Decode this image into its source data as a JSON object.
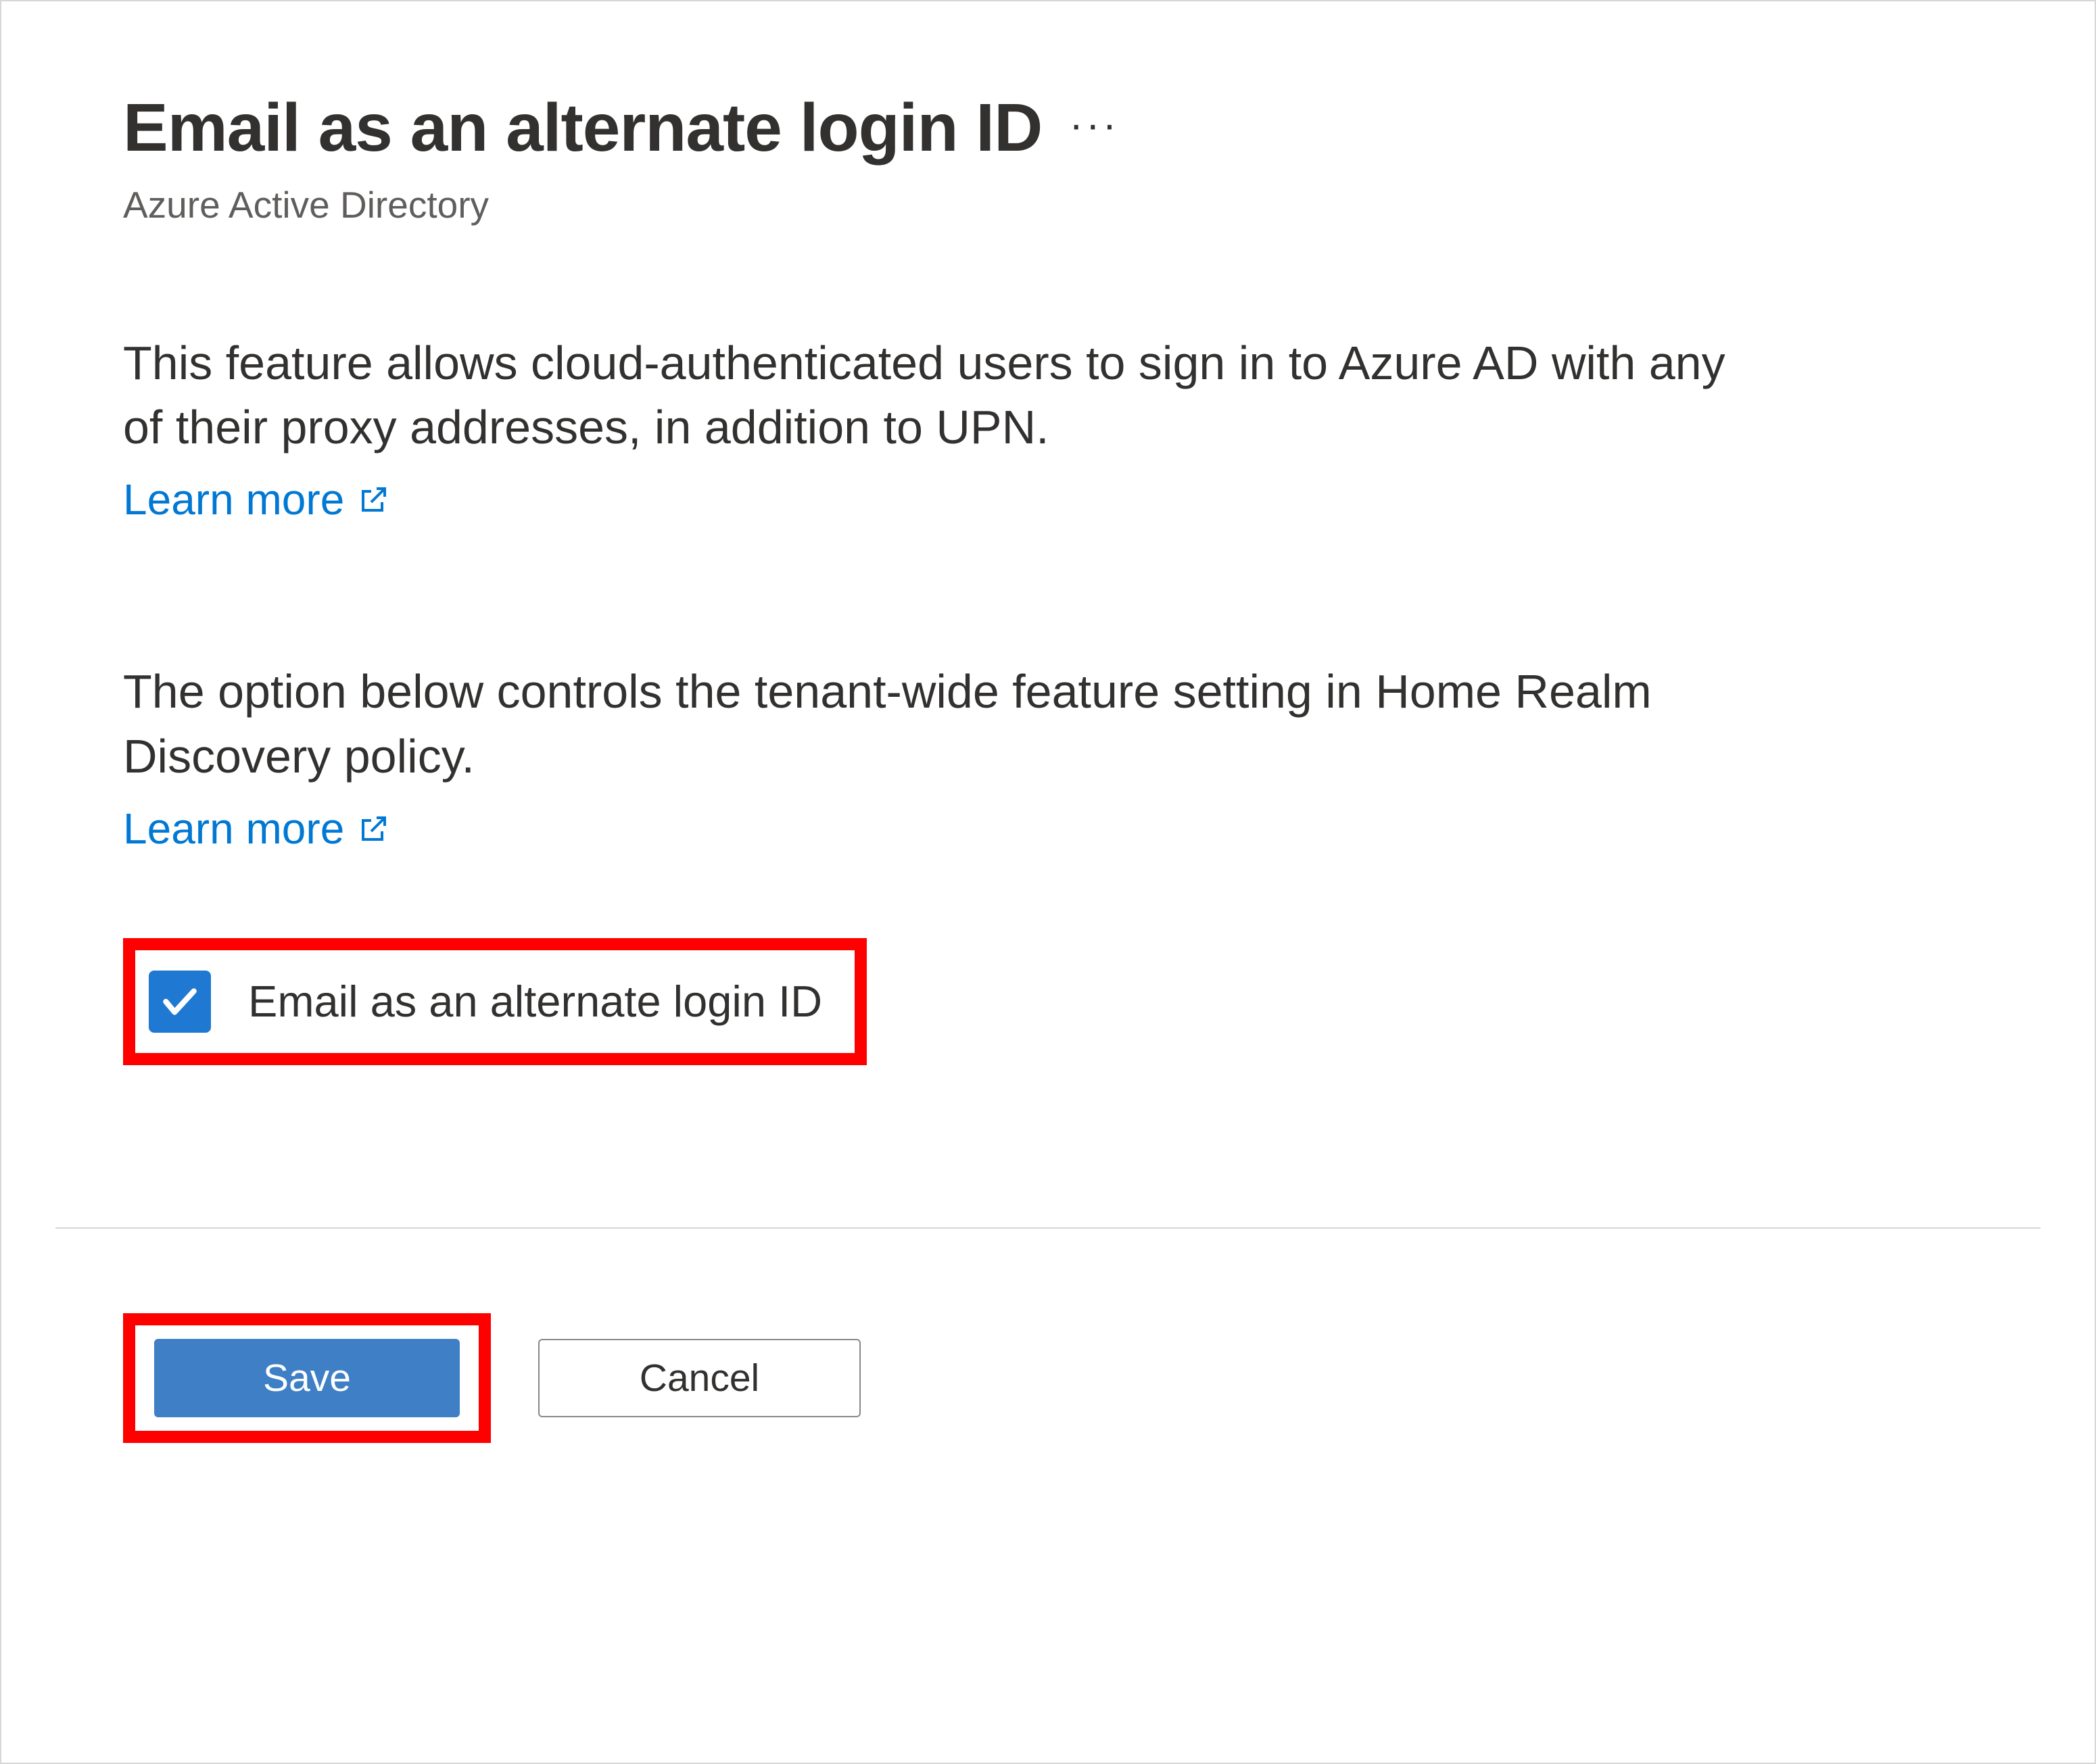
{
  "header": {
    "title": "Email as an alternate login ID",
    "subtitle": "Azure Active Directory"
  },
  "description1": {
    "text": "This feature allows cloud-authenticated users to sign in to Azure AD with any of their proxy addresses, in addition to UPN.",
    "learn_more": "Learn more"
  },
  "description2": {
    "text": "The option below controls the tenant-wide feature setting in Home Realm Discovery policy.",
    "learn_more": "Learn more"
  },
  "checkbox": {
    "label": "Email as an alternate login ID",
    "checked": true
  },
  "buttons": {
    "save": "Save",
    "cancel": "Cancel"
  }
}
